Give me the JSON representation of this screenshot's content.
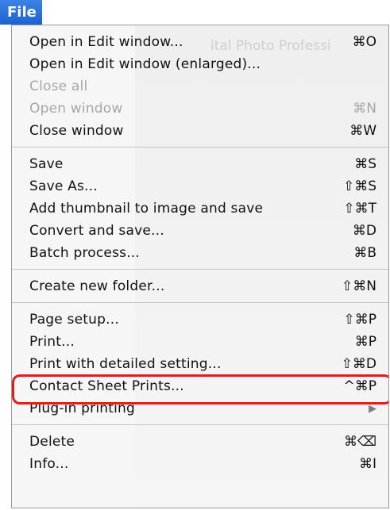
{
  "menu": {
    "title": "File",
    "ghost_text": "ital Photo Professi",
    "items": [
      {
        "label": "Open in Edit window...",
        "shortcut": "⌘O"
      },
      {
        "label": "Open in Edit window (enlarged)...",
        "shortcut": ""
      },
      {
        "label": "Close all",
        "shortcut": ""
      },
      {
        "label": "Open window",
        "shortcut": "⌘N"
      },
      {
        "label": "Close window",
        "shortcut": "⌘W"
      },
      {
        "label": "Save",
        "shortcut": "⌘S"
      },
      {
        "label": "Save As...",
        "shortcut": "⇧⌘S"
      },
      {
        "label": "Add thumbnail to image and save",
        "shortcut": "⇧⌘T"
      },
      {
        "label": "Convert and save...",
        "shortcut": "⌘D"
      },
      {
        "label": "Batch process...",
        "shortcut": "⌘B"
      },
      {
        "label": "Create new folder...",
        "shortcut": "⇧⌘N"
      },
      {
        "label": "Page setup...",
        "shortcut": "⇧⌘P"
      },
      {
        "label": "Print...",
        "shortcut": "⌘P"
      },
      {
        "label": "Print with detailed setting...",
        "shortcut": "⇧⌘D"
      },
      {
        "label": "Contact Sheet Prints...",
        "shortcut": "^⌘P"
      },
      {
        "label": "Plug-in printing",
        "submenu_icon": "▶"
      },
      {
        "label": "Delete",
        "shortcut": "⌘⌫"
      },
      {
        "label": "Info...",
        "shortcut": "⌘I"
      }
    ]
  },
  "colors": {
    "menu_title_bg": "#2b74dc",
    "disabled_text": "#a7a7a7",
    "highlight_ring": "#e41b1b"
  }
}
